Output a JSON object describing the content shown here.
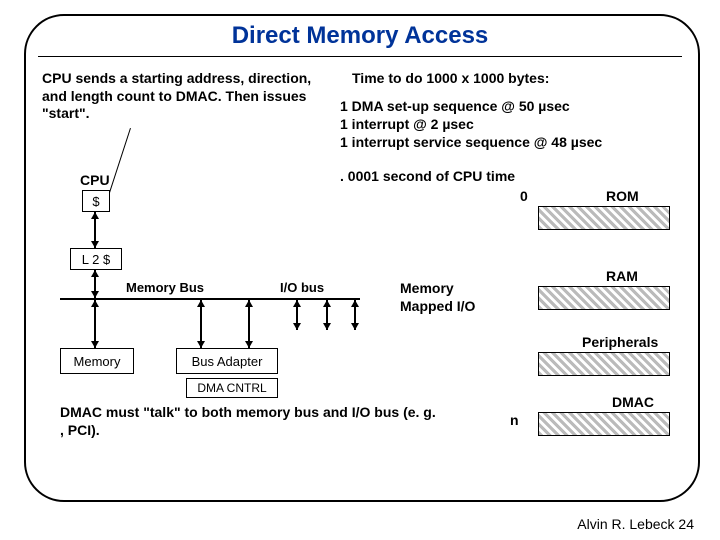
{
  "title": "Direct Memory Access",
  "left_note": "CPU sends a starting address, direction, and length count to DMAC. Then issues \"start\".",
  "right_heading": "Time to do 1000 x 1000 bytes:",
  "right_lines": {
    "l1": "1 DMA set-up sequence @ 50 µsec",
    "l2": "1 interrupt @ 2 µsec",
    "l3": "1 interrupt service sequence @ 48 µsec"
  },
  "summary1": ". 0001 second of CPU time",
  "summary2": "0",
  "blocks": {
    "cpu": "CPU",
    "cache": "$",
    "l2": "L 2 $",
    "memory": "Memory",
    "busadapter": "Bus Adapter",
    "dmacntrl": "DMA CNTRL"
  },
  "buses": {
    "membus": "Memory Bus",
    "iobus": "I/O bus"
  },
  "map": {
    "rom": "ROM",
    "ram": "RAM",
    "periph": "Peripherals",
    "dmac": "DMAC",
    "mmio": "Memory Mapped I/O",
    "n": "n"
  },
  "bottom_note": "DMAC must \"talk\" to both memory bus and I/O bus (e. g. , PCI).",
  "footer": "Alvin R. Lebeck 24"
}
